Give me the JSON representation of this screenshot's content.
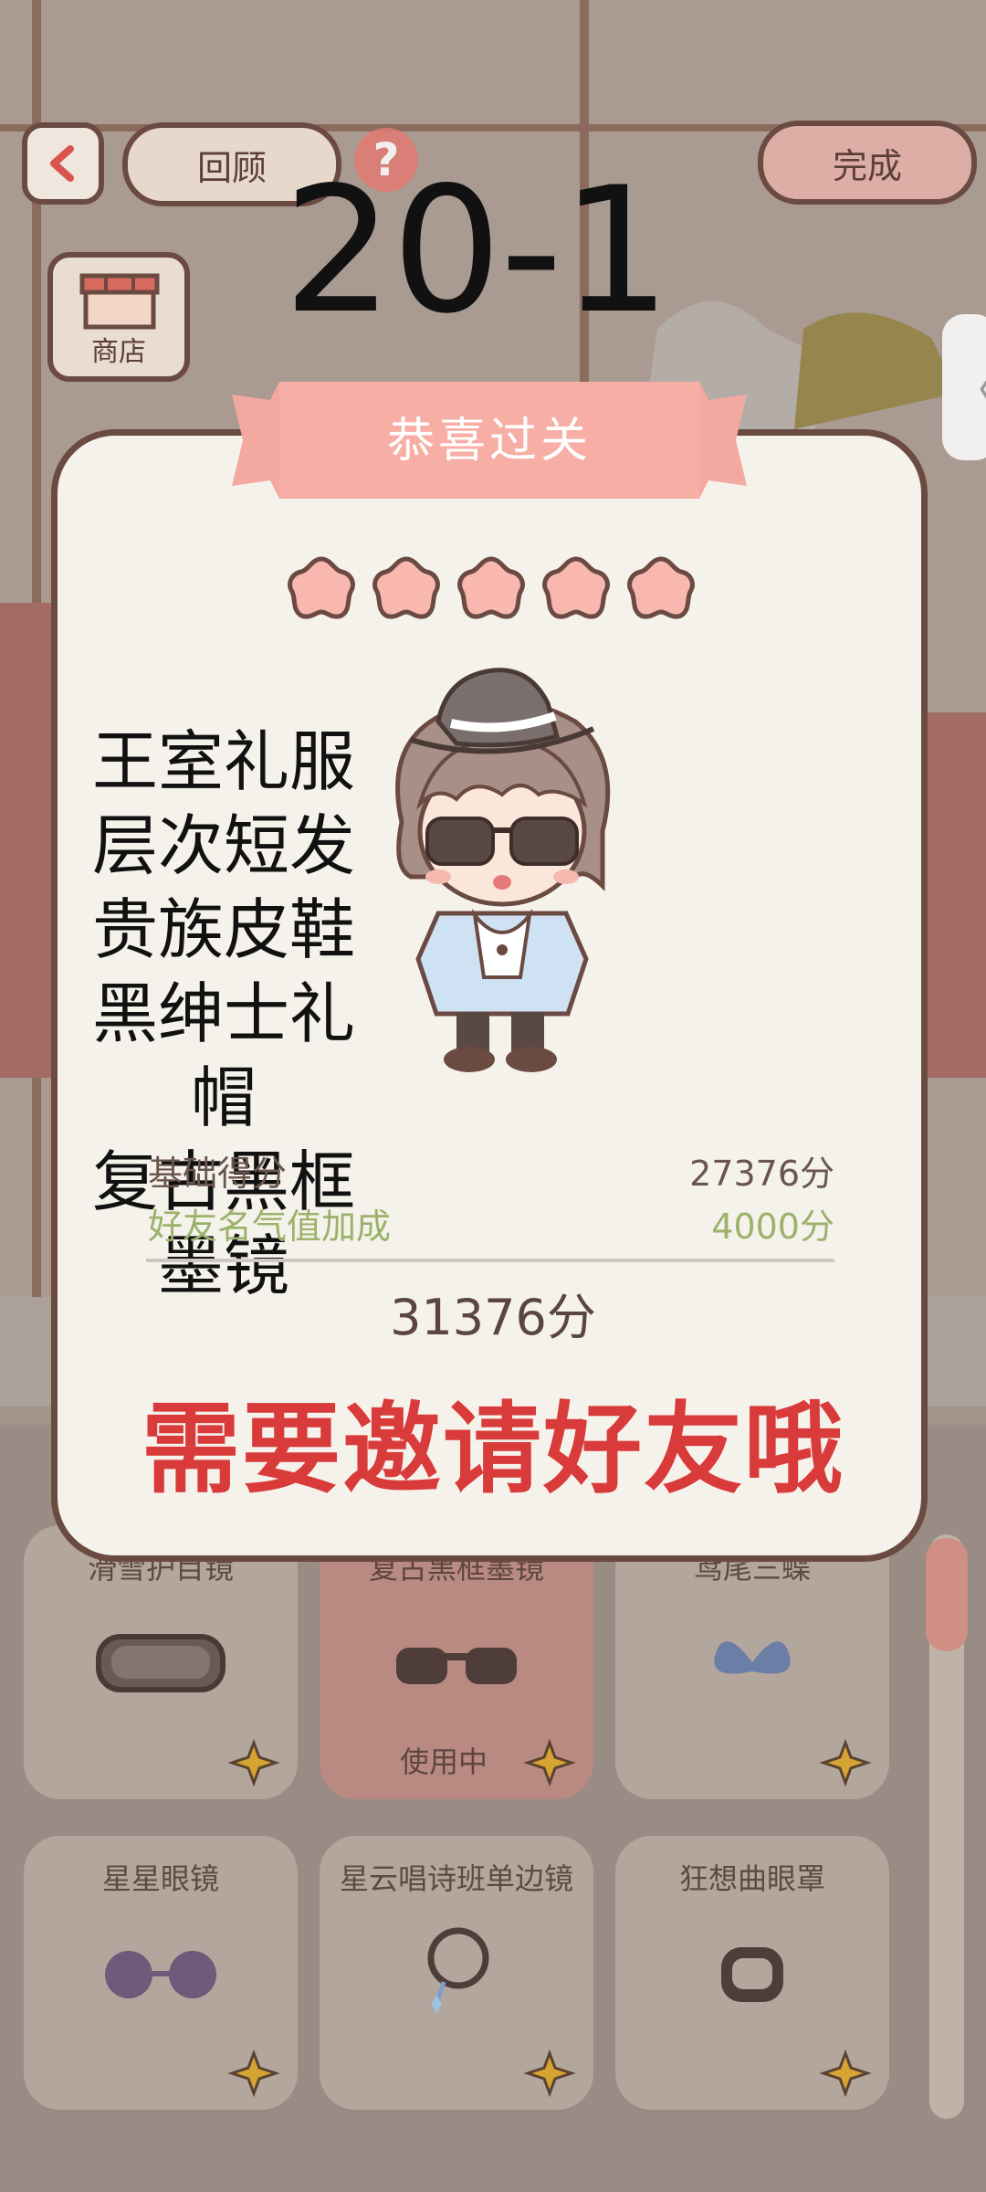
{
  "header": {
    "review_label": "回顾",
    "done_label": "完成",
    "level": "20-1",
    "help_icon": "question-icon"
  },
  "shop": {
    "label": "商店"
  },
  "modal": {
    "banner_title": "恭喜过关",
    "stars_filled": 5,
    "stars_total": 5,
    "outfit_items": [
      "王室礼服",
      "层次短发",
      "贵族皮鞋",
      "黑绅士礼帽",
      "复古黑框墨镜"
    ],
    "scores": {
      "base_label": "基础得分",
      "base_value": "27376分",
      "bonus_label": "好友名气值加成",
      "bonus_value": "4000分",
      "total": "31376分"
    },
    "invite_message": "需要邀请好友哦"
  },
  "items": [
    {
      "name": "滑雪护目镜",
      "in_use": false,
      "icon": "ski-goggles-icon"
    },
    {
      "name": "复古黑框墨镜",
      "in_use": true,
      "status": "使用中",
      "icon": "sunglasses-icon"
    },
    {
      "name": "鸢尾三蝶",
      "in_use": false,
      "icon": "butterfly-icon"
    },
    {
      "name": "星星眼镜",
      "in_use": false,
      "icon": "flower-glasses-icon"
    },
    {
      "name": "星云唱诗班单边镜",
      "in_use": false,
      "icon": "monocle-icon"
    },
    {
      "name": "狂想曲眼罩",
      "in_use": false,
      "icon": "eye-mask-icon"
    }
  ],
  "colors": {
    "accent": "#d93a3a",
    "banner": "#f4a9a0",
    "star": "#f8b8b0",
    "outline": "#6b4a42",
    "bonus": "#9bb26a"
  }
}
